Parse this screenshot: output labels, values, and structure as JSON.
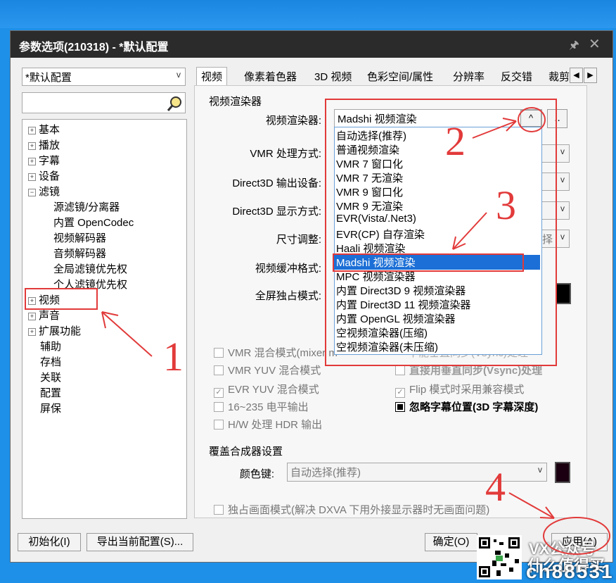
{
  "window": {
    "title": "参数选项(210318) - *默认配置"
  },
  "sidebar": {
    "profile": "*默认配置",
    "search_placeholder": "",
    "tree": {
      "basic": "基本",
      "playback": "播放",
      "subtitle": "字幕",
      "devices": "设备",
      "filters": "滤镜",
      "filters_children": [
        "源滤镜/分离器",
        "内置 OpenCodec",
        "视频解码器",
        "音频解码器",
        "全局滤镜优先权",
        "个人滤镜优先权"
      ],
      "video": "视频",
      "audio": "声音",
      "extensions": "扩展功能",
      "assist": "辅助",
      "archive": "存档",
      "association": "关联",
      "config": "配置",
      "screensaver": "屏保"
    }
  },
  "tabs": [
    "视频",
    "像素着色器",
    "3D 视频",
    "色彩空间/属性",
    "分辨率",
    "反交错",
    "裁剪"
  ],
  "video": {
    "group_renderer": "视频渲染器",
    "renderer_label": "视频渲染器:",
    "renderer_value": "Madshi 视频渲染",
    "browse_btn": "..",
    "vmr_mode_label": "VMR 处理方式:",
    "d3d_device_label": "Direct3D 输出设备:",
    "d3d_display_label": "Direct3D 显示方式:",
    "size_label": "尺寸调整:",
    "size_value_partial": "择",
    "buffer_label": "视频缓冲格式:",
    "fullscreen_label": "全屏独占模式:",
    "checks_left": [
      {
        "label": "VMR 混合模式(mixer m",
        "checked": false
      },
      {
        "label": "VMR YUV 混合模式",
        "checked": false
      },
      {
        "label": "EVR YUV 混合模式",
        "checked": true
      },
      {
        "label": "16~235 电平输出",
        "checked": false
      },
      {
        "label": "H/W 处理 HDR 输出",
        "checked": false
      }
    ],
    "checks_right": [
      {
        "label": "直接用垂直同步(Vsync)处理",
        "checked": false,
        "bold": true
      },
      {
        "label": "Flip 模式时采用兼容模式",
        "checked": true,
        "bold": false
      },
      {
        "label": "忽略字幕位置(3D 字幕深度)",
        "checked": true,
        "bold": true
      }
    ],
    "right_partial_text": "不能垂直同步(Vsync)处理",
    "group_overlay": "覆盖合成器设置",
    "color_key_label": "颜色键:",
    "color_key_value": "自动选择(推荐)",
    "exclusive_label": "独占画面模式(解决 DXVA 下用外接显示器时无画面问题)"
  },
  "dropdown_options": [
    "自动选择(推荐)",
    "普通视频渲染",
    "VMR 7 窗口化",
    "VMR 7 无渲染",
    "VMR 9 窗口化",
    "VMR 9 无渲染",
    "EVR(Vista/.Net3)",
    "EVR(CP) 自存渲染",
    "Haali 视频渲染",
    "Madshi 视频渲染",
    "MPC 视频渲染器",
    "内置 Direct3D 9 视频渲染器",
    "内置 Direct3D 11 视频渲染器",
    "内置 OpenGL 视频渲染器",
    "空视频渲染器(压缩)",
    "空视频渲染器(未压缩)"
  ],
  "dropdown_selected_index": 9,
  "buttons": {
    "init": "初始化(I)",
    "export": "导出当前配置(S)...",
    "ok": "确定(O)",
    "apply": "应用(A)"
  },
  "annotations": [
    "1",
    "2",
    "3",
    "4"
  ],
  "watermark": {
    "line1": "VX公众号",
    "line2": "什么值得买",
    "line3": "ch88531"
  },
  "colors": {
    "accent": "#1c6fd6",
    "annotation": "#e23a3a",
    "titlebar": "#2b2b2b"
  }
}
